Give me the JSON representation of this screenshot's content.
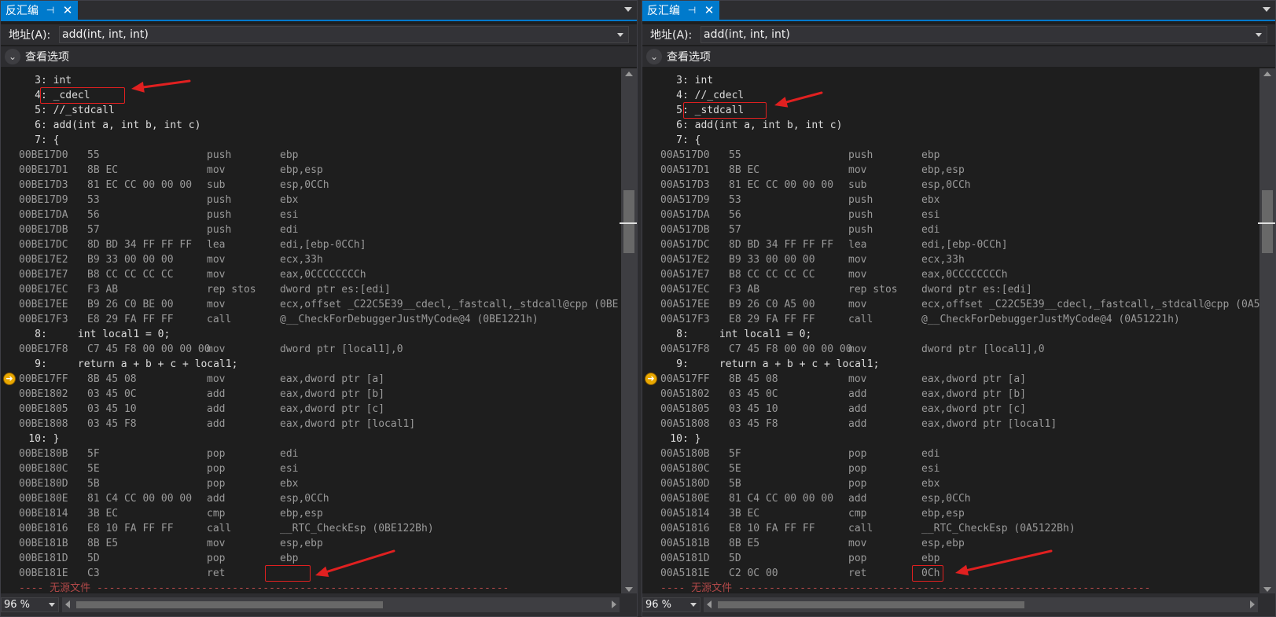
{
  "colors": {
    "accent": "#007acc",
    "background": "#1e1e1e",
    "annotation_red": "#e02020",
    "ip_marker": "#e8a800"
  },
  "icons": {
    "pin": "pin-icon",
    "close": "close-icon",
    "expand": "chevron-down-icon",
    "instruction_pointer": "current-instruction-arrow-icon"
  },
  "panes": [
    {
      "tab_title": "反汇编",
      "address_label": "地址(A):",
      "address_value": "add(int, int, int)",
      "view_options_label": "查看选项",
      "zoom": "96 %",
      "source_lines": [
        {
          "text": "     3: int",
          "row": 0
        },
        {
          "text": "     4: _cdecl",
          "row": 1
        },
        {
          "text": "     5: //_stdcall",
          "row": 2
        },
        {
          "text": "     6: add(int a, int b, int c)",
          "row": 3
        },
        {
          "text": "     7: {",
          "row": 4
        },
        {
          "text": "     8:     int local1 = 0;",
          "row": 17
        },
        {
          "text": "     9:     return a + b + c + local1;",
          "row": 19
        },
        {
          "text": "    10: }",
          "row": 24
        }
      ],
      "asm_lines": [
        {
          "row": 5,
          "addr": "00BE17D0",
          "bytes": "55",
          "mnem": "push",
          "ops": "ebp"
        },
        {
          "row": 6,
          "addr": "00BE17D1",
          "bytes": "8B EC",
          "mnem": "mov",
          "ops": "ebp,esp"
        },
        {
          "row": 7,
          "addr": "00BE17D3",
          "bytes": "81 EC CC 00 00 00",
          "mnem": "sub",
          "ops": "esp,0CCh"
        },
        {
          "row": 8,
          "addr": "00BE17D9",
          "bytes": "53",
          "mnem": "push",
          "ops": "ebx"
        },
        {
          "row": 9,
          "addr": "00BE17DA",
          "bytes": "56",
          "mnem": "push",
          "ops": "esi"
        },
        {
          "row": 10,
          "addr": "00BE17DB",
          "bytes": "57",
          "mnem": "push",
          "ops": "edi"
        },
        {
          "row": 11,
          "addr": "00BE17DC",
          "bytes": "8D BD 34 FF FF FF",
          "mnem": "lea",
          "ops": "edi,[ebp-0CCh]"
        },
        {
          "row": 12,
          "addr": "00BE17E2",
          "bytes": "B9 33 00 00 00",
          "mnem": "mov",
          "ops": "ecx,33h"
        },
        {
          "row": 13,
          "addr": "00BE17E7",
          "bytes": "B8 CC CC CC CC",
          "mnem": "mov",
          "ops": "eax,0CCCCCCCCh"
        },
        {
          "row": 14,
          "addr": "00BE17EC",
          "bytes": "F3 AB",
          "mnem": "rep stos",
          "ops": "dword ptr es:[edi]"
        },
        {
          "row": 15,
          "addr": "00BE17EE",
          "bytes": "B9 26 C0 BE 00",
          "mnem": "mov",
          "ops": "ecx,offset _C22C5E39__cdecl,_fastcall,_stdcall@cpp (0BE"
        },
        {
          "row": 16,
          "addr": "00BE17F3",
          "bytes": "E8 29 FA FF FF",
          "mnem": "call",
          "ops": "@__CheckForDebuggerJustMyCode@4 (0BE1221h)"
        },
        {
          "row": 18,
          "addr": "00BE17F8",
          "bytes": "C7 45 F8 00 00 00 00",
          "mnem": "mov",
          "ops": "dword ptr [local1],0"
        },
        {
          "row": 20,
          "addr": "00BE17FF",
          "bytes": "8B 45 08",
          "mnem": "mov",
          "ops": "eax,dword ptr [a]"
        },
        {
          "row": 21,
          "addr": "00BE1802",
          "bytes": "03 45 0C",
          "mnem": "add",
          "ops": "eax,dword ptr [b]"
        },
        {
          "row": 22,
          "addr": "00BE1805",
          "bytes": "03 45 10",
          "mnem": "add",
          "ops": "eax,dword ptr [c]"
        },
        {
          "row": 23,
          "addr": "00BE1808",
          "bytes": "03 45 F8",
          "mnem": "add",
          "ops": "eax,dword ptr [local1]"
        },
        {
          "row": 25,
          "addr": "00BE180B",
          "bytes": "5F",
          "mnem": "pop",
          "ops": "edi"
        },
        {
          "row": 26,
          "addr": "00BE180C",
          "bytes": "5E",
          "mnem": "pop",
          "ops": "esi"
        },
        {
          "row": 27,
          "addr": "00BE180D",
          "bytes": "5B",
          "mnem": "pop",
          "ops": "ebx"
        },
        {
          "row": 28,
          "addr": "00BE180E",
          "bytes": "81 C4 CC 00 00 00",
          "mnem": "add",
          "ops": "esp,0CCh"
        },
        {
          "row": 29,
          "addr": "00BE1814",
          "bytes": "3B EC",
          "mnem": "cmp",
          "ops": "ebp,esp"
        },
        {
          "row": 30,
          "addr": "00BE1816",
          "bytes": "E8 10 FA FF FF",
          "mnem": "call",
          "ops": "__RTC_CheckEsp (0BE122Bh)"
        },
        {
          "row": 31,
          "addr": "00BE181B",
          "bytes": "8B E5",
          "mnem": "mov",
          "ops": "esp,ebp"
        },
        {
          "row": 32,
          "addr": "00BE181D",
          "bytes": "5D",
          "mnem": "pop",
          "ops": "ebp"
        },
        {
          "row": 33,
          "addr": "00BE181E",
          "bytes": "C3",
          "mnem": "ret",
          "ops": ""
        }
      ],
      "no_source_text": "---- 无源文件 -------------------------------------------------------------------"
    },
    {
      "tab_title": "反汇编",
      "address_label": "地址(A):",
      "address_value": "add(int, int, int)",
      "view_options_label": "查看选项",
      "zoom": "96 %",
      "source_lines": [
        {
          "text": "     3: int",
          "row": 0
        },
        {
          "text": "     4: //_cdecl",
          "row": 1
        },
        {
          "text": "     5: _stdcall",
          "row": 2
        },
        {
          "text": "     6: add(int a, int b, int c)",
          "row": 3
        },
        {
          "text": "     7: {",
          "row": 4
        },
        {
          "text": "     8:     int local1 = 0;",
          "row": 17
        },
        {
          "text": "     9:     return a + b + c + local1;",
          "row": 19
        },
        {
          "text": "    10: }",
          "row": 24
        }
      ],
      "asm_lines": [
        {
          "row": 5,
          "addr": "00A517D0",
          "bytes": "55",
          "mnem": "push",
          "ops": "ebp"
        },
        {
          "row": 6,
          "addr": "00A517D1",
          "bytes": "8B EC",
          "mnem": "mov",
          "ops": "ebp,esp"
        },
        {
          "row": 7,
          "addr": "00A517D3",
          "bytes": "81 EC CC 00 00 00",
          "mnem": "sub",
          "ops": "esp,0CCh"
        },
        {
          "row": 8,
          "addr": "00A517D9",
          "bytes": "53",
          "mnem": "push",
          "ops": "ebx"
        },
        {
          "row": 9,
          "addr": "00A517DA",
          "bytes": "56",
          "mnem": "push",
          "ops": "esi"
        },
        {
          "row": 10,
          "addr": "00A517DB",
          "bytes": "57",
          "mnem": "push",
          "ops": "edi"
        },
        {
          "row": 11,
          "addr": "00A517DC",
          "bytes": "8D BD 34 FF FF FF",
          "mnem": "lea",
          "ops": "edi,[ebp-0CCh]"
        },
        {
          "row": 12,
          "addr": "00A517E2",
          "bytes": "B9 33 00 00 00",
          "mnem": "mov",
          "ops": "ecx,33h"
        },
        {
          "row": 13,
          "addr": "00A517E7",
          "bytes": "B8 CC CC CC CC",
          "mnem": "mov",
          "ops": "eax,0CCCCCCCCh"
        },
        {
          "row": 14,
          "addr": "00A517EC",
          "bytes": "F3 AB",
          "mnem": "rep stos",
          "ops": "dword ptr es:[edi]"
        },
        {
          "row": 15,
          "addr": "00A517EE",
          "bytes": "B9 26 C0 A5 00",
          "mnem": "mov",
          "ops": "ecx,offset _C22C5E39__cdecl,_fastcall,_stdcall@cpp (0A5("
        },
        {
          "row": 16,
          "addr": "00A517F3",
          "bytes": "E8 29 FA FF FF",
          "mnem": "call",
          "ops": "@__CheckForDebuggerJustMyCode@4 (0A51221h)"
        },
        {
          "row": 18,
          "addr": "00A517F8",
          "bytes": "C7 45 F8 00 00 00 00",
          "mnem": "mov",
          "ops": "dword ptr [local1],0"
        },
        {
          "row": 20,
          "addr": "00A517FF",
          "bytes": "8B 45 08",
          "mnem": "mov",
          "ops": "eax,dword ptr [a]"
        },
        {
          "row": 21,
          "addr": "00A51802",
          "bytes": "03 45 0C",
          "mnem": "add",
          "ops": "eax,dword ptr [b]"
        },
        {
          "row": 22,
          "addr": "00A51805",
          "bytes": "03 45 10",
          "mnem": "add",
          "ops": "eax,dword ptr [c]"
        },
        {
          "row": 23,
          "addr": "00A51808",
          "bytes": "03 45 F8",
          "mnem": "add",
          "ops": "eax,dword ptr [local1]"
        },
        {
          "row": 25,
          "addr": "00A5180B",
          "bytes": "5F",
          "mnem": "pop",
          "ops": "edi"
        },
        {
          "row": 26,
          "addr": "00A5180C",
          "bytes": "5E",
          "mnem": "pop",
          "ops": "esi"
        },
        {
          "row": 27,
          "addr": "00A5180D",
          "bytes": "5B",
          "mnem": "pop",
          "ops": "ebx"
        },
        {
          "row": 28,
          "addr": "00A5180E",
          "bytes": "81 C4 CC 00 00 00",
          "mnem": "add",
          "ops": "esp,0CCh"
        },
        {
          "row": 29,
          "addr": "00A51814",
          "bytes": "3B EC",
          "mnem": "cmp",
          "ops": "ebp,esp"
        },
        {
          "row": 30,
          "addr": "00A51816",
          "bytes": "E8 10 FA FF FF",
          "mnem": "call",
          "ops": "__RTC_CheckEsp (0A5122Bh)"
        },
        {
          "row": 31,
          "addr": "00A5181B",
          "bytes": "8B E5",
          "mnem": "mov",
          "ops": "esp,ebp"
        },
        {
          "row": 32,
          "addr": "00A5181D",
          "bytes": "5D",
          "mnem": "pop",
          "ops": "ebp"
        },
        {
          "row": 33,
          "addr": "00A5181E",
          "bytes": "C2 0C 00",
          "mnem": "ret",
          "ops": "0Ch"
        }
      ],
      "no_source_text": "---- 无源文件 -------------------------------------------------------------------"
    }
  ]
}
